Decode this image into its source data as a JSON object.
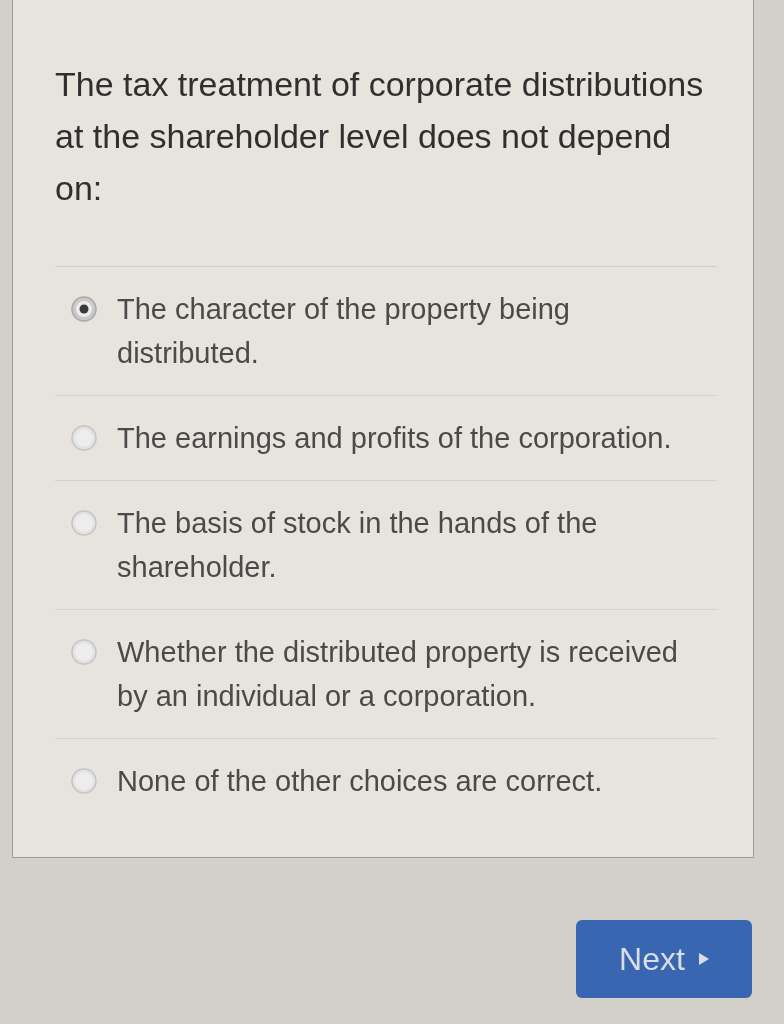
{
  "question": {
    "text": "The tax treatment of corporate distributions at the shareholder level does not depend on:"
  },
  "options": [
    {
      "text": "The character of the property being distributed.",
      "selected": true
    },
    {
      "text": "The earnings and profits of the corporation.",
      "selected": false
    },
    {
      "text": "The basis of stock in the hands of the shareholder.",
      "selected": false
    },
    {
      "text": "Whether the distributed property is received by an individual or a corporation.",
      "selected": false
    },
    {
      "text": "None of the other choices are correct.",
      "selected": false
    }
  ],
  "next_button": {
    "label": "Next"
  }
}
